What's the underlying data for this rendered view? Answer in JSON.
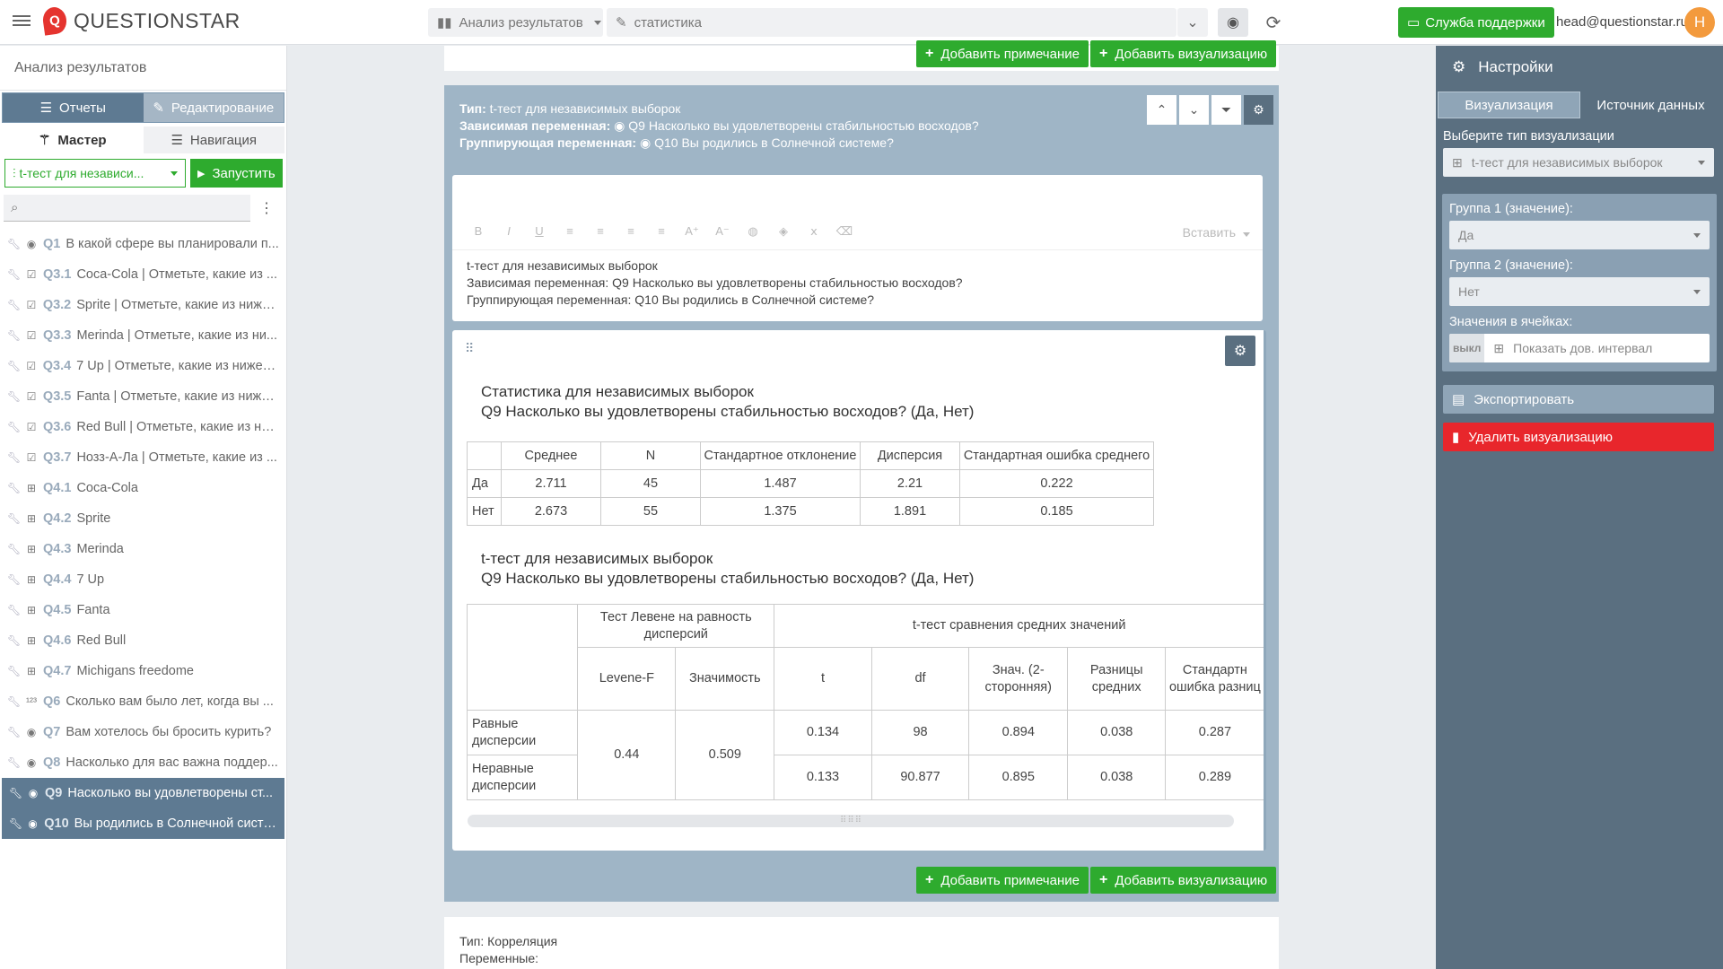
{
  "brand": {
    "logo_mark": "Q",
    "name": "QUESTIONSTAR"
  },
  "topbar": {
    "section_dropdown": "Анализ результатов",
    "report_dropdown": "статистика",
    "support_label": "Служба поддержки",
    "user_email": "head@questionstar.ru",
    "avatar_letter": "H"
  },
  "left": {
    "title": "Анализ результатов",
    "mode_tabs": [
      "Отчеты",
      "Редактирование"
    ],
    "panel_tabs": [
      "Мастер",
      "Навигация"
    ],
    "test_select": "t-тест для независи...",
    "run_label": "Запустить",
    "questions": [
      {
        "id": "Q1",
        "text": "В какой сфере вы планировали п...",
        "icon": "radio-icon"
      },
      {
        "id": "Q3.1",
        "text": "Coca-Cola | Отметьте, какие из ...",
        "icon": "checkbox-icon"
      },
      {
        "id": "Q3.2",
        "text": "Sprite | Отметьте, какие из ниже...",
        "icon": "checkbox-icon"
      },
      {
        "id": "Q3.3",
        "text": "Merinda | Отметьте, какие из ни...",
        "icon": "checkbox-icon"
      },
      {
        "id": "Q3.4",
        "text": "7 Up | Отметьте, какие из нижеп...",
        "icon": "checkbox-icon"
      },
      {
        "id": "Q3.5",
        "text": "Fanta | Отметьте, какие из ниже...",
        "icon": "checkbox-icon"
      },
      {
        "id": "Q3.6",
        "text": "Red Bull | Отметьте, какие из ни...",
        "icon": "checkbox-icon"
      },
      {
        "id": "Q3.7",
        "text": "Нозз-А-Ла | Отметьте, какие из ...",
        "icon": "checkbox-icon"
      },
      {
        "id": "Q4.1",
        "text": "Coca-Cola",
        "icon": "table-icon"
      },
      {
        "id": "Q4.2",
        "text": "Sprite",
        "icon": "table-icon"
      },
      {
        "id": "Q4.3",
        "text": "Merinda",
        "icon": "table-icon"
      },
      {
        "id": "Q4.4",
        "text": "7 Up",
        "icon": "table-icon"
      },
      {
        "id": "Q4.5",
        "text": "Fanta",
        "icon": "table-icon"
      },
      {
        "id": "Q4.6",
        "text": "Red Bull",
        "icon": "table-icon"
      },
      {
        "id": "Q4.7",
        "text": "Michigans freedome",
        "icon": "table-icon"
      },
      {
        "id": "Q6",
        "text": "Сколько вам было лет, когда вы ...",
        "icon": "number-icon"
      },
      {
        "id": "Q7",
        "text": "Вам хотелось бы бросить курить?",
        "icon": "radio-icon"
      },
      {
        "id": "Q8",
        "text": "Насколько для вас важна поддер...",
        "icon": "radio-icon"
      },
      {
        "id": "Q9",
        "text": "Насколько вы удовлетворены ст...",
        "icon": "radio-icon",
        "selected": true
      },
      {
        "id": "Q10",
        "text": "Вы родились в Солнечной систе...",
        "icon": "radio-icon",
        "selected": true
      }
    ]
  },
  "center": {
    "add_note_label": "Добавить примечание",
    "add_viz_label": "Добавить визуализацию",
    "block": {
      "type_label": "Тип:",
      "type_value": "t-тест для независимых выборок",
      "dep_label": "Зависимая переменная:",
      "dep_value": "Q9 Насколько вы удовлетворены стабильностью восходов?",
      "group_label": "Группирующая переменная:",
      "group_value": "Q10 Вы родились в Солнечной системе?"
    },
    "editor": {
      "insert_label": "Вставить",
      "line1": "t-тест для независимых выборок",
      "dep_label": "Зависимая переменная:",
      "dep_value": "Q9 Насколько вы удовлетворены стабильностью восходов?",
      "group_label": "Группирующая переменная:",
      "group_value": "Q10 Вы родились в Солнечной системе?"
    },
    "stats": {
      "title1": "Статистика для независимых выборок",
      "title2": "Q9 Насколько вы удовлетворены стабильностью восходов? (Да, Нет)",
      "headers": [
        "",
        "Среднее",
        "N",
        "Стандартное отклонение",
        "Дисперсия",
        "Стандартная ошибка среднего"
      ],
      "rows": [
        [
          "Да",
          "2.711",
          "45",
          "1.487",
          "2.21",
          "0.222"
        ],
        [
          "Нет",
          "2.673",
          "55",
          "1.375",
          "1.891",
          "0.185"
        ]
      ]
    },
    "ttest": {
      "title1": "t-тест для независимых выборок",
      "title2": "Q9 Насколько вы удовлетворены стабильностью восходов? (Да, Нет)",
      "group_levene": "Тест Левене на равность дисперсий",
      "group_ttest": "t-тест сравнения средних значений",
      "sub_headers": [
        "Levene-F",
        "Значимость",
        "t",
        "df",
        "Знач. (2-сторонняя)",
        "Разницы средних",
        "Стандартн ошибка разниц"
      ],
      "levene_f": "0.44",
      "levene_sig": "0.509",
      "rows": [
        {
          "label": "Равные дисперсии",
          "values": [
            "0.134",
            "98",
            "0.894",
            "0.038",
            "0.287"
          ]
        },
        {
          "label": "Неравные дисперсии",
          "values": [
            "0.133",
            "90.877",
            "0.895",
            "0.038",
            "0.289"
          ]
        }
      ]
    },
    "next_block": {
      "type_label": "Тип:",
      "type_value": "Корреляция",
      "vars_label": "Переменные:"
    }
  },
  "right": {
    "title": "Настройки",
    "tabs": [
      "Визуализация",
      "Источник данных"
    ],
    "viz_type_label": "Выберите тип визуализации",
    "viz_type_value": "t-тест для независимых выборок",
    "group1_label": "Группа 1 (значение):",
    "group1_value": "Да",
    "group2_label": "Группа 2 (значение):",
    "group2_value": "Нет",
    "cells_label": "Значения в ячейках:",
    "toggle_off": "выкл",
    "toggle_label": "Показать дов. интервал",
    "export_label": "Экспортировать",
    "delete_label": "Удалить визуализацию"
  },
  "colors": {
    "accent_green": "#2eab2e",
    "panel_slate": "#5a6f80",
    "danger_red": "#e8262c",
    "brand_red": "#e5342f"
  }
}
